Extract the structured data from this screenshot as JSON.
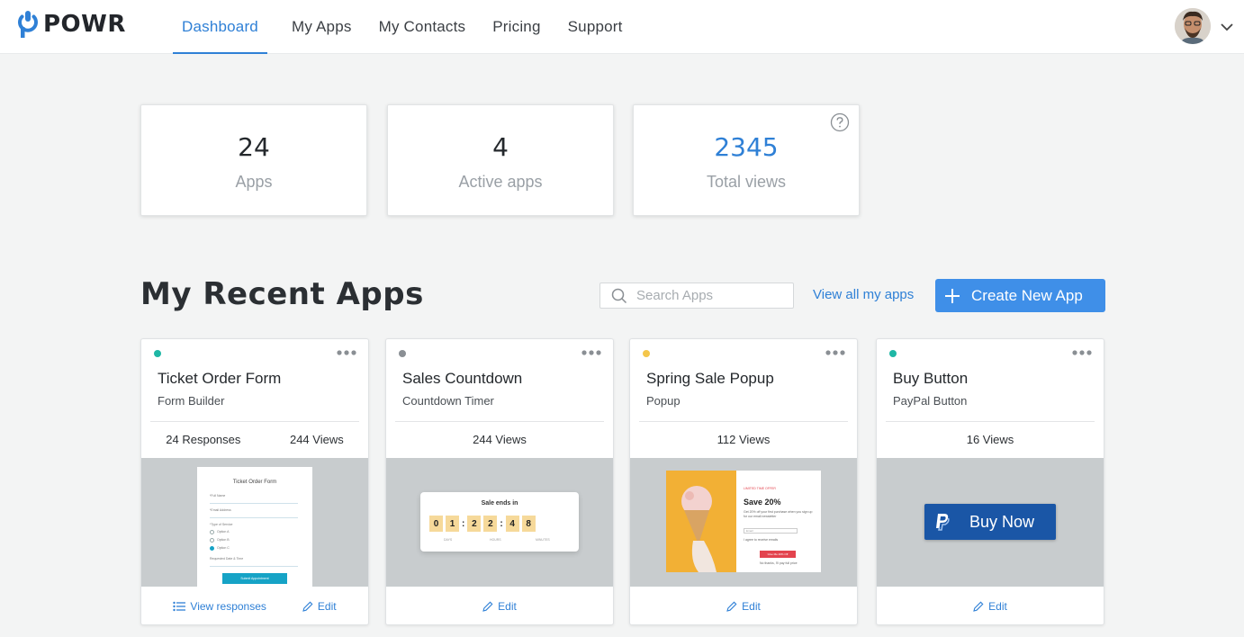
{
  "brand": {
    "name": "POWR",
    "accent": "#2f80d6"
  },
  "nav": {
    "items": [
      {
        "label": "Dashboard",
        "active": true
      },
      {
        "label": "My Apps"
      },
      {
        "label": "My Contacts"
      },
      {
        "label": "Pricing"
      },
      {
        "label": "Support"
      }
    ]
  },
  "stats": [
    {
      "value": "24",
      "label": "Apps"
    },
    {
      "value": "4",
      "label": "Active apps"
    },
    {
      "value": "2345",
      "label": "Total views",
      "help_icon": "question-circle-icon"
    }
  ],
  "recent": {
    "title": "My Recent Apps",
    "search_placeholder": "Search Apps",
    "view_all": "View all my apps",
    "create_label": "Create New App"
  },
  "apps": [
    {
      "name": "Ticket Order Form",
      "type": "Form Builder",
      "status_color": "#1fb7a5",
      "metrics": [
        "24 Responses",
        "244 Views"
      ],
      "preview": {
        "title": "Ticket Order Form",
        "fields": [
          "*Full Name",
          "*Email Address",
          "*Type of Service",
          "Option A",
          "Option B",
          "Option C",
          "Requested Date & Time"
        ],
        "button": "Submit Appointment"
      },
      "actions": [
        "View responses",
        "Edit"
      ]
    },
    {
      "name": "Sales Countdown",
      "type": "Countdown Timer",
      "status_color": "#8a8f94",
      "metrics": [
        "244 Views"
      ],
      "preview": {
        "title": "Sale ends in",
        "digits": [
          "0",
          "1",
          "2",
          "2",
          "4",
          "8"
        ],
        "units": [
          "DAYS",
          "HOURS",
          "MINUTES"
        ]
      },
      "actions": [
        "Edit"
      ]
    },
    {
      "name": "Spring Sale Popup",
      "type": "Popup",
      "status_color": "#f4c64b",
      "metrics": [
        "112 Views"
      ],
      "preview": {
        "kicker": "LIMITED TIME OFFER",
        "headline": "Save 20%",
        "body": "Get 20% off your first purchase when you sign up for our email newsletter",
        "field": "Email",
        "checkbox": "I agree to receive emails",
        "button": "Give Me 20% Off",
        "dismiss": "No thanks, I'll pay full price"
      },
      "actions": [
        "Edit"
      ]
    },
    {
      "name": "Buy Button",
      "type": "PayPal Button",
      "status_color": "#1fb7a5",
      "metrics": [
        "16 Views"
      ],
      "preview": {
        "button": "Buy Now"
      },
      "actions": [
        "Edit"
      ]
    }
  ]
}
